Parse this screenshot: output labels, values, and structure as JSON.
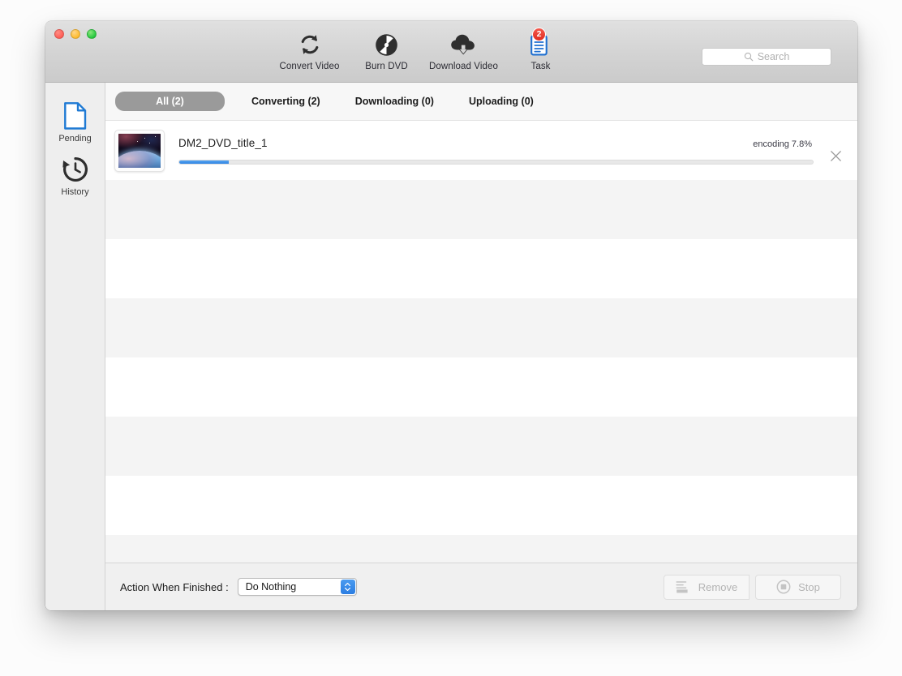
{
  "window": {
    "traffic_lights": [
      "close",
      "minimize",
      "maximize"
    ]
  },
  "toolbar": {
    "items": [
      {
        "label": "Convert Video",
        "icon": "convert-video-icon",
        "badge": null
      },
      {
        "label": "Burn DVD",
        "icon": "burn-dvd-icon",
        "badge": null
      },
      {
        "label": "Download Video",
        "icon": "download-video-icon",
        "badge": null
      },
      {
        "label": "Task",
        "icon": "task-clipboard-icon",
        "badge": "2"
      }
    ],
    "search": {
      "placeholder": "Search",
      "value": "",
      "icon": "search-icon"
    }
  },
  "sidebar": {
    "items": [
      {
        "label": "Pending",
        "icon": "document-page-icon",
        "active": true
      },
      {
        "label": "History",
        "icon": "clock-history-icon",
        "active": false
      }
    ]
  },
  "tabs": [
    {
      "label": "All (2)",
      "active": true
    },
    {
      "label": "Converting (2)",
      "active": false
    },
    {
      "label": "Downloading (0)",
      "active": false
    },
    {
      "label": "Uploading (0)",
      "active": false
    }
  ],
  "tasks": [
    {
      "title": "DM2_DVD_title_1",
      "status": "encoding 7.8%",
      "progress_percent": 7.8,
      "thumbnail": "earth-from-space-thumbnail",
      "close_icon": "close-x-icon"
    }
  ],
  "empty_rows": 8,
  "bottom_bar": {
    "action_label": "Action When Finished :",
    "action_select": {
      "value": "Do Nothing",
      "options": [
        "Do Nothing"
      ],
      "icon": "stepper-updown-icon"
    },
    "buttons": [
      {
        "label": "Remove",
        "icon": "remove-list-icon",
        "disabled": true
      },
      {
        "label": "Stop",
        "icon": "stop-circle-icon",
        "disabled": true
      }
    ]
  },
  "colors": {
    "accent_blue": "#2f84e3",
    "badge_red": "#e02c20",
    "sidebar_bg": "#eeeeee",
    "active_tab_bg": "#9a9a9a",
    "row_stripe": "#f4f4f4"
  }
}
